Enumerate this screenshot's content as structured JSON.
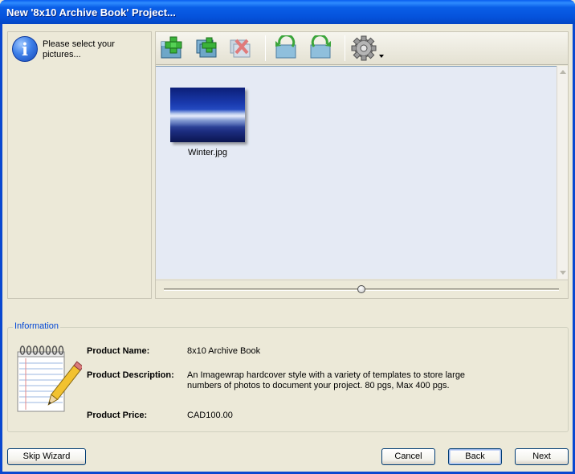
{
  "window": {
    "title": "New '8x10 Archive Book' Project..."
  },
  "left_panel": {
    "message": "Please select your pictures..."
  },
  "toolbar": {
    "buttons": [
      {
        "name": "add-picture-button",
        "icon": "folder-add-icon"
      },
      {
        "name": "add-multiple-button",
        "icon": "add-copies-icon"
      },
      {
        "name": "remove-picture-button",
        "icon": "remove-icon"
      },
      {
        "name": "rotate-left-button",
        "icon": "rotate-left-icon"
      },
      {
        "name": "rotate-right-button",
        "icon": "rotate-right-icon"
      },
      {
        "name": "settings-button",
        "icon": "gear-icon"
      }
    ]
  },
  "pictures": [
    {
      "filename": "Winter.jpg"
    }
  ],
  "zoom_slider": {
    "value_fraction": 0.5
  },
  "information": {
    "legend": "Information",
    "product_name_label": "Product Name:",
    "product_name": "8x10 Archive Book",
    "product_description_label": "Product Description:",
    "product_description": "An Imagewrap hardcover style with a variety of templates to store large numbers of photos to document your project. 80 pgs, Max 400 pgs.",
    "product_price_label": "Product Price:",
    "product_price": "CAD100.00"
  },
  "buttons": {
    "skip": "Skip Wizard",
    "cancel": "Cancel",
    "back": "Back",
    "next": "Next"
  },
  "colors": {
    "title_bar": "#0553DC",
    "window_bg": "#ECE9D8",
    "thumb_area_bg": "#E5EAF4",
    "legend_text": "#0046D5"
  }
}
